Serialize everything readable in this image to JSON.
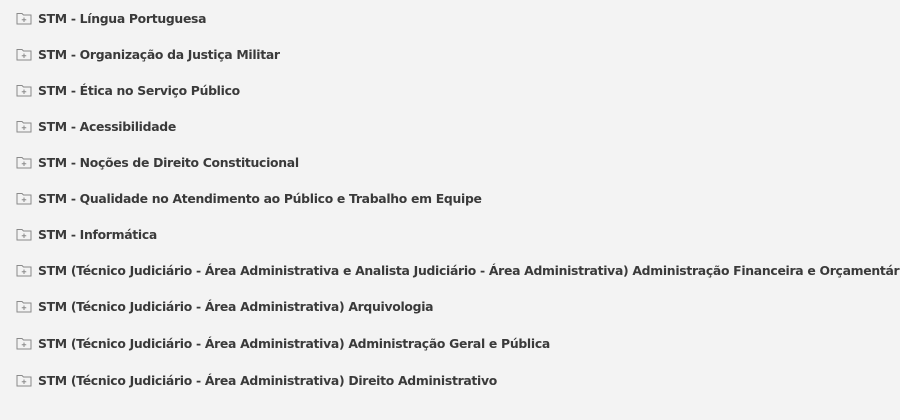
{
  "folders": [
    {
      "label": "STM - Língua Portuguesa"
    },
    {
      "label": "STM - Organização da Justiça Militar"
    },
    {
      "label": "STM - Ética no Serviço Público"
    },
    {
      "label": "STM - Acessibilidade"
    },
    {
      "label": "STM - Noções de Direito Constitucional"
    },
    {
      "label": "STM - Qualidade no Atendimento ao Público e Trabalho em Equipe"
    },
    {
      "label": "STM - Informática"
    },
    {
      "label": "STM (Técnico Judiciário - Área Administrativa e Analista Judiciário - Área Administrativa) Administração Financeira e Orçamentária"
    },
    {
      "label": "STM (Técnico Judiciário - Área Administrativa) Arquivologia"
    },
    {
      "label": "STM (Técnico Judiciário - Área Administrativa) Administração Geral e Pública"
    },
    {
      "label": "STM (Técnico Judiciário - Área Administrativa) Direito Administrativo"
    }
  ],
  "icons": {
    "folder": "folder-plus-icon"
  },
  "colors": {
    "background": "#f3f3f3",
    "text": "#3a3a3a",
    "icon_stroke": "#8a8a8a"
  }
}
